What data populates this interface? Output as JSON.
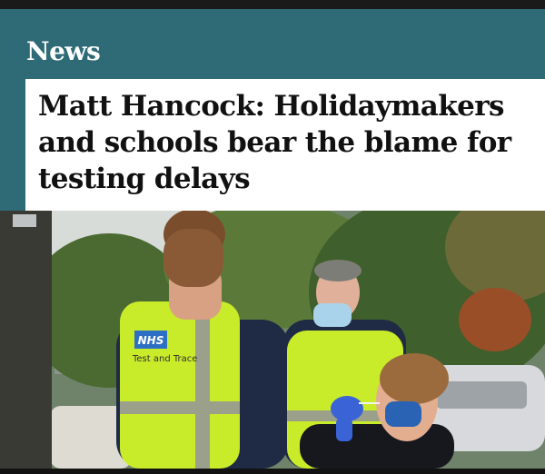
{
  "section": {
    "label": "News"
  },
  "article": {
    "headline": "Matt Hancock: Holidaymakers and schools bear the blame for testing delays",
    "image": {
      "vest_badge": "NHS",
      "vest_text": "Test and Trace"
    }
  },
  "colors": {
    "header_bg": "#2e6b77",
    "vest": "#c9ec2a",
    "nhs_blue": "#2d6fc4"
  }
}
